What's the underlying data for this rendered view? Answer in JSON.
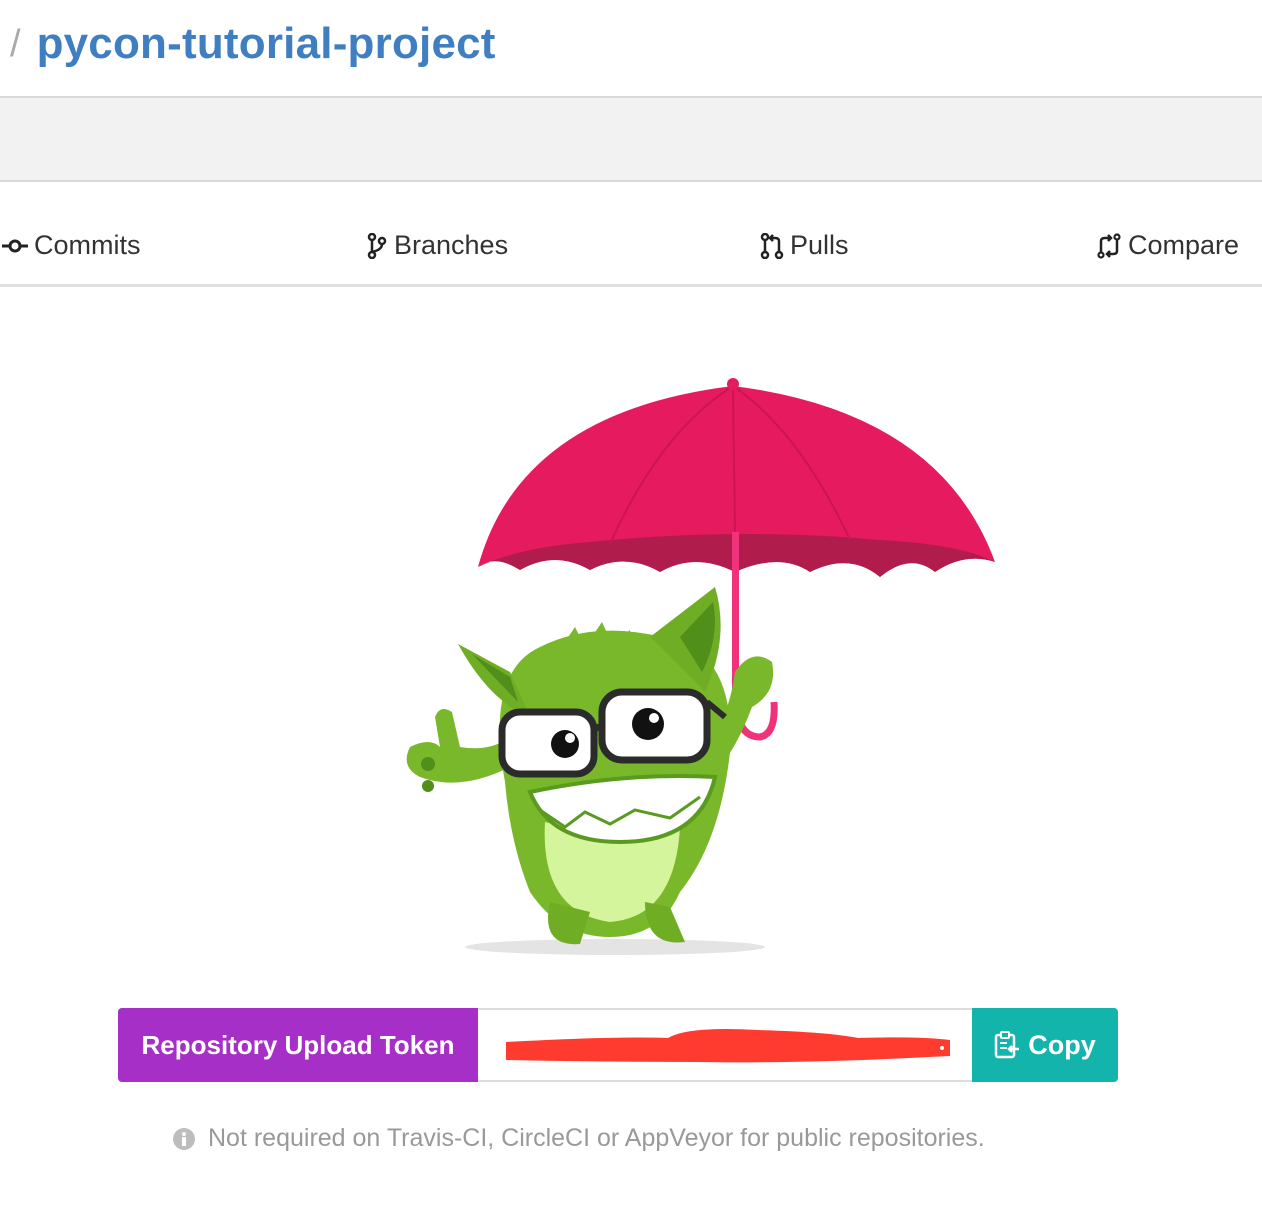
{
  "breadcrumb": {
    "separator": "/",
    "repo_name": "pycon-tutorial-project"
  },
  "tabs": [
    {
      "label": "Commits",
      "icon": "commit-icon"
    },
    {
      "label": "Branches",
      "icon": "branch-icon"
    },
    {
      "label": "Pulls",
      "icon": "pull-request-icon"
    },
    {
      "label": "Compare",
      "icon": "compare-icon"
    }
  ],
  "token": {
    "label": "Repository Upload Token",
    "value": "",
    "copy_label": "Copy"
  },
  "note": "Not required on Travis-CI, CircleCI or AppVeyor for public repositories.",
  "colors": {
    "link": "#3f7fc1",
    "token_label_bg": "#a62fc7",
    "copy_bg": "#13b4ac",
    "umbrella": "#e61a5f",
    "mascot": "#7dbd24",
    "redaction": "#ff3b30"
  }
}
